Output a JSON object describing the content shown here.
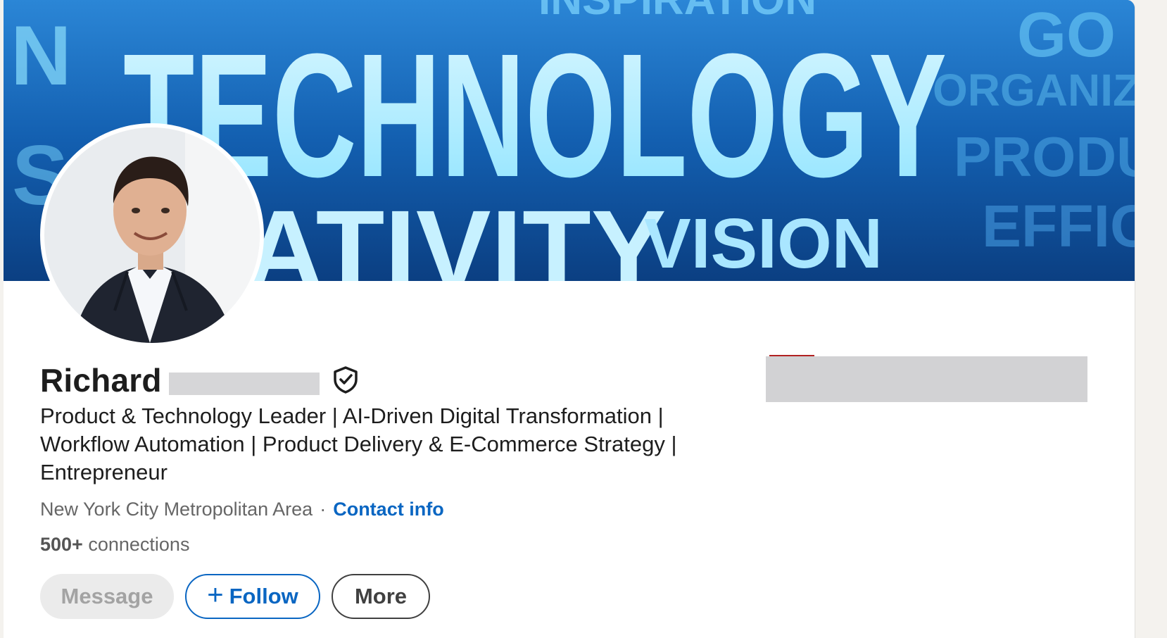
{
  "profile": {
    "banner_words": {
      "main": "TECHNOLOGY",
      "bottom_left": "ATIVITY",
      "bottom_right": "VISION",
      "top_left": "N",
      "left_side": "S",
      "right_top": "GO",
      "right_1": "ORGANIZ",
      "right_2": "PRODU",
      "right_3": "EFFIC",
      "top_center": "INSPIRATION"
    },
    "name": "Richard",
    "name_redacted": true,
    "headline": "Product & Technology Leader | AI-Driven Digital Transformation | Workflow Automation | Product Delivery & E-Commerce Strategy | Entrepreneur",
    "location": "New York City Metropolitan Area",
    "separator": "·",
    "contact_info_label": "Contact info",
    "connections_count": "500+",
    "connections_label": "connections",
    "actions": {
      "message_label": "Message",
      "follow_plus": "+",
      "follow_label": "Follow",
      "more_label": "More"
    },
    "icons": {
      "verified": "shield-check-icon",
      "follow_plus": "plus-icon"
    },
    "colors": {
      "link_blue": "#0a66c2",
      "banner_blue": "#1158a6",
      "text_dark": "#1d1d1d",
      "text_muted": "#666666"
    }
  }
}
